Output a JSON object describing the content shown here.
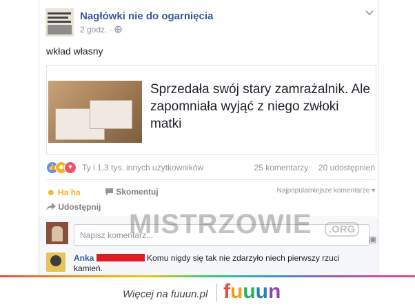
{
  "post": {
    "page_name": "Nagłówki nie do ogarnięcia",
    "avatar_lines": [
      "DIANA WAS STILL",
      "ALIVE HOURS",
      "BEFORE SHE DIED"
    ],
    "time": "2 godz.",
    "separator": "·",
    "privacy_icon": "globe-icon",
    "menu_icon": "chevron-down-icon",
    "text": "wkład własny"
  },
  "link": {
    "headline": "Sprzedała swój stary zamrażalnik. Ale zapomniała wyjąć z niego zwłoki matki"
  },
  "reactions": {
    "icons": [
      "like-icon",
      "haha-icon",
      "love-icon"
    ],
    "summary": "Ty i 1,3 tys. innych użytkowników",
    "comments": "25 komentarzy",
    "shares": "20 udostępnień"
  },
  "actions": {
    "haha": "Ha ha",
    "comment": "Skomentuj",
    "sort": "Najpopularniejsze komentarze",
    "share": "Udostępnij"
  },
  "comment_box": {
    "placeholder": "Napisz komentarz..."
  },
  "comment": {
    "name": "Anka",
    "text": "Komu nigdy się tak nie zdarzyło niech pierwszy rzuci kamień."
  },
  "watermark": {
    "text": "MISTRZOWIE",
    "suffix": ".ORG"
  },
  "footer": {
    "more": "Więcej na fuuun.pl",
    "brand_letters": [
      "f",
      "u",
      "u",
      "u",
      "n"
    ],
    "brand_colors": [
      "#e74c3c",
      "#f39c12",
      "#27ae60",
      "#2980b9",
      "#8e44ad"
    ]
  },
  "colors": {
    "link_blue": "#365899",
    "haha_yellow": "#f7b125",
    "like_blue": "#5890ff",
    "love_red": "#f25268"
  }
}
